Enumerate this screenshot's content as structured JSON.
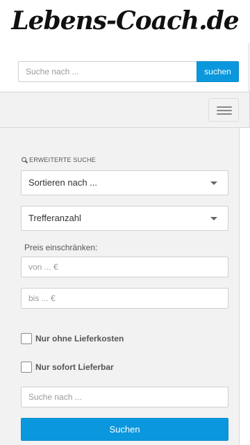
{
  "header": {
    "logo_text": "Lebens-Coach.de",
    "search_placeholder": "Suche nach ...",
    "search_button": "suchen"
  },
  "navbar": {
    "toggle_icon": "hamburger-menu-icon"
  },
  "sidebar": {
    "advanced_search_title": "ERWEITERTE SUCHE",
    "advanced_search_icon": "search-icon",
    "sort_select": "Sortieren nach ...",
    "results_select": "Trefferanzahl",
    "price_label": "Preis einschränken:",
    "price_from_placeholder": "von ... €",
    "price_to_placeholder": "bis ... €",
    "checkbox_free_shipping": "Nur ohne Lieferkosten",
    "checkbox_immediate": "Nur sofort Lieferbar",
    "search_placeholder": "Suche nach ...",
    "submit_button": "Suchen"
  },
  "colors": {
    "accent": "#0a97dd",
    "panel_background": "#f2f2f2",
    "border": "#cfcfcf"
  }
}
